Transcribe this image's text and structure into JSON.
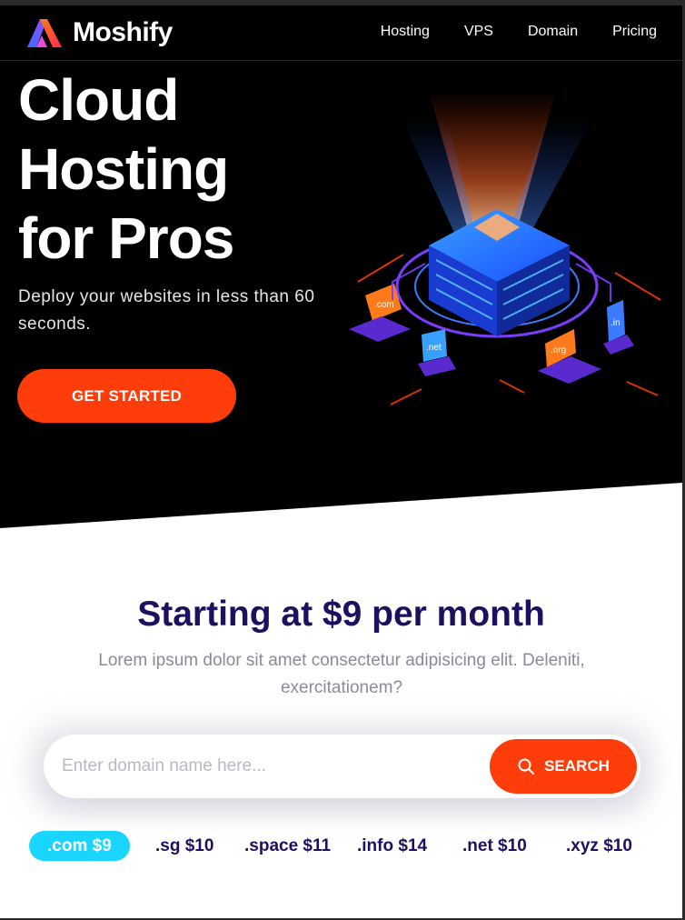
{
  "brand": {
    "name": "Moshify"
  },
  "nav": {
    "items": [
      "Hosting",
      "VPS",
      "Domain",
      "Pricing"
    ]
  },
  "hero": {
    "title_lines": [
      "Cloud",
      "Hosting",
      "for Pros"
    ],
    "subtitle": "Deploy your websites in less than 60 seconds.",
    "cta_label": "GET STARTED"
  },
  "illustration": {
    "tags": [
      ".com",
      ".net",
      ".org",
      ".in"
    ]
  },
  "pricing": {
    "title": "Starting at $9 per month",
    "subtitle": "Lorem ipsum dolor sit amet consectetur adipisicing elit. Deleniti, exercitationem?"
  },
  "search": {
    "placeholder": "Enter domain name here...",
    "button_label": "SEARCH"
  },
  "tlds": [
    ".com $9",
    ".sg $10",
    ".space $11",
    ".info $14",
    ".net $10",
    ".xyz $10"
  ],
  "colors": {
    "accent": "#ff3d0a",
    "navy": "#1c1060",
    "cyan": "#1ad5ff",
    "hero_bg": "#000000"
  }
}
